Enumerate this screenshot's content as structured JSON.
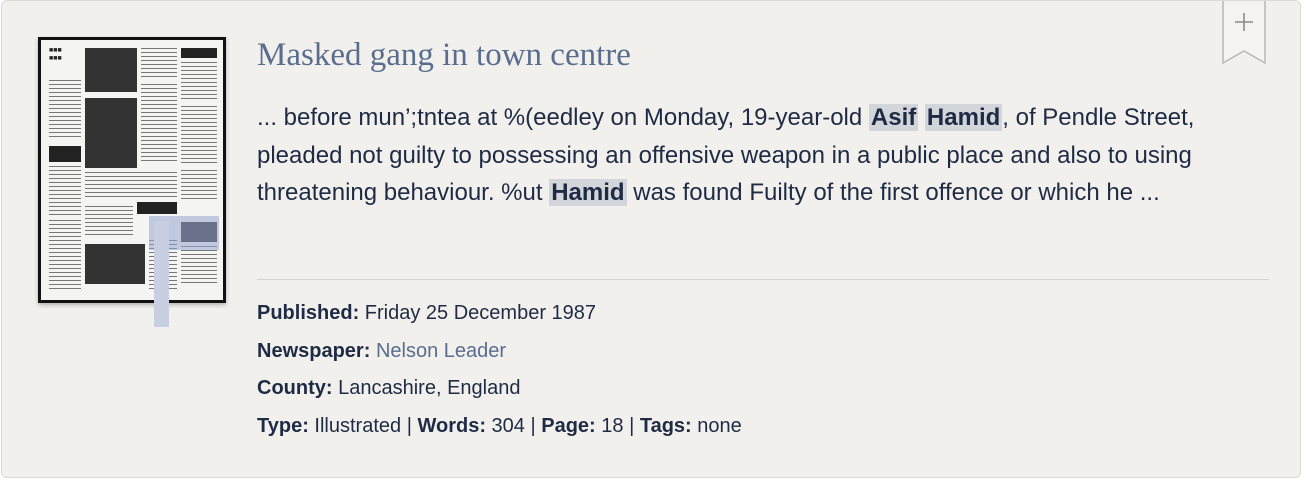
{
  "article": {
    "title": "Masked gang in town centre",
    "snippet": {
      "part1": "... before mun’;tntea at %(eedley on Monday, 19-year-old ",
      "hl1": "Asif",
      "space": " ",
      "hl2": "Hamid",
      "part2": ", of Pendle Street, pleaded not guilty to possessing an offensive weapon in a public place and also to using threatening behaviour. %ut ",
      "hl3": "Hamid",
      "part3": " was found Fuilty of the first offence or which he ..."
    }
  },
  "meta": {
    "published_label": "Published:",
    "published_value": "Friday 25 December 1987",
    "newspaper_label": "Newspaper:",
    "newspaper_value": "Nelson Leader",
    "county_label": "County:",
    "county_value": "Lancashire, England",
    "type_label": "Type:",
    "type_value": "Illustrated",
    "sep": "|",
    "words_label": "Words:",
    "words_value": "304",
    "page_label": "Page:",
    "page_value": "18",
    "tags_label": "Tags:",
    "tags_value": "none"
  },
  "icons": {
    "bookmark": "bookmark-add-icon",
    "thumbnail": "newspaper-page-thumbnail"
  },
  "colors": {
    "background": "#f1f0ed",
    "title": "#5a6d8f",
    "text": "#1f2a44",
    "highlight": "#d2d6da",
    "link": "#5a6d8f"
  }
}
